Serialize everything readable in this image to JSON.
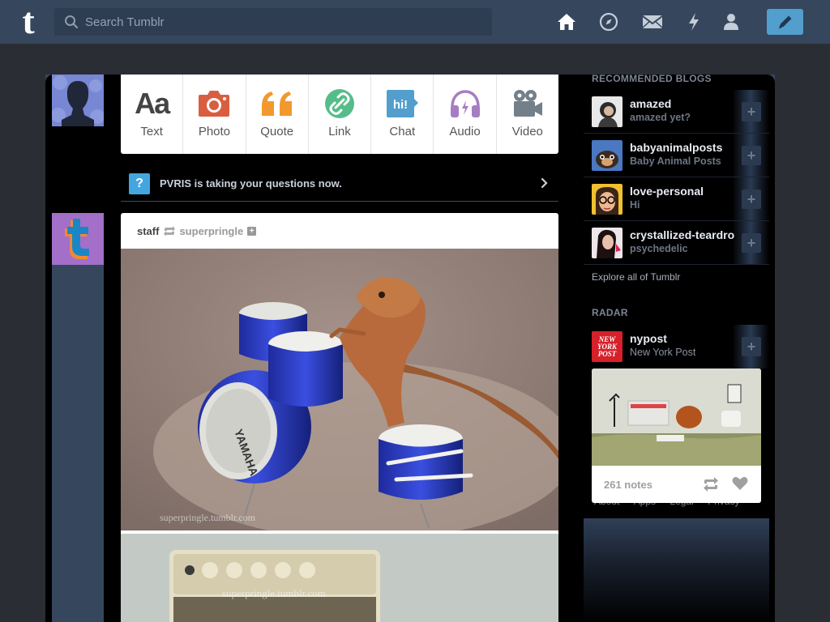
{
  "header": {
    "logo": "t",
    "search_placeholder": "Search Tumblr",
    "nav_icons": [
      "home-icon",
      "explore-compass-icon",
      "inbox-mail-icon",
      "activity-lightning-icon",
      "account-person-icon"
    ],
    "compose_icon": "pencil-icon",
    "accent": "#529ecc",
    "header_bg": "#36465d"
  },
  "post_types": [
    {
      "label": "Text",
      "icon": "text-aa-icon",
      "color": "#444444"
    },
    {
      "label": "Photo",
      "icon": "camera-icon",
      "color": "#d95e40"
    },
    {
      "label": "Quote",
      "icon": "quote-icon",
      "color": "#f2992e"
    },
    {
      "label": "Link",
      "icon": "link-icon",
      "color": "#56bc8a"
    },
    {
      "label": "Chat",
      "icon": "chat-hi-icon",
      "color": "#529ecc"
    },
    {
      "label": "Audio",
      "icon": "headphones-icon",
      "color": "#a77dc2"
    },
    {
      "label": "Video",
      "icon": "video-camera-icon",
      "color": "#748089"
    }
  ],
  "banner": {
    "text": "PVRIS is taking your questions now."
  },
  "post": {
    "author": "staff",
    "reblogged_from": "superpringle",
    "watermark": "superpringle.tumblr.com"
  },
  "sidebar": {
    "recommended_heading": "RECOMMENDED BLOGS",
    "recommended": [
      {
        "name": "amazed",
        "subtitle": "amazed yet?"
      },
      {
        "name": "babyanimalposts",
        "subtitle": "Baby Animal Posts"
      },
      {
        "name": "love-personal",
        "subtitle": "Hi"
      },
      {
        "name": "crystallized-teardrops",
        "subtitle": "psychedelic"
      }
    ],
    "explore": "Explore all of Tumblr",
    "radar_heading": "RADAR",
    "radar": {
      "name": "nypost",
      "subtitle": "New York Post",
      "avatar_text": "NEW YORK POST",
      "notes": "261 notes"
    },
    "footer_links": [
      "About",
      "Apps",
      "Legal",
      "Privacy"
    ]
  }
}
